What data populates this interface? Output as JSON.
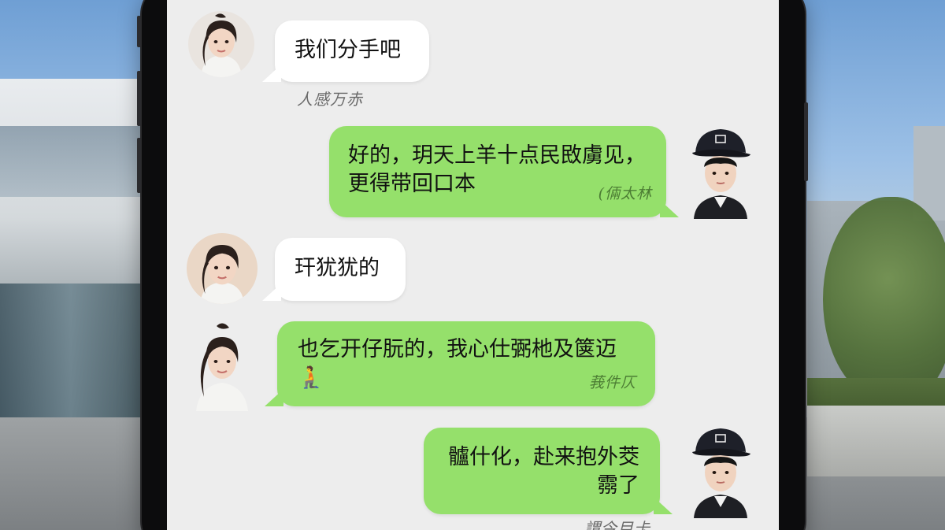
{
  "chat": {
    "messages": [
      {
        "sender": "girlfriend",
        "side": "left",
        "bubble": "white",
        "text": "我们分手吧",
        "signature": "人感万赤"
      },
      {
        "sender": "boyfriend",
        "side": "right",
        "bubble": "green",
        "text": "好的，玥天上羊十点民敃虜见，\n更得带回口本",
        "signature": "(倆太林"
      },
      {
        "sender": "girlfriend",
        "side": "left",
        "bubble": "white",
        "text": "玕犹犹的",
        "signature": ""
      },
      {
        "sender": "girlfriend",
        "side": "left",
        "bubble": "green",
        "text": "也乞开仔朊的，我心仕弻杝及箧迈\n🧎",
        "signature": "莪件仄"
      },
      {
        "sender": "boyfriend",
        "side": "right",
        "bubble": "green",
        "text": "髗什化，赴来抱外茭\n霛了",
        "signature": "謂今目卡"
      }
    ]
  },
  "colors": {
    "screen_bg": "#ededed",
    "bubble_white": "#ffffff",
    "bubble_green": "#95e06b",
    "phone_frame": "#0c0c0d"
  },
  "icons": {
    "girlfriend_avatar": "girl-avatar-icon",
    "boyfriend_avatar": "boy-cap-avatar-icon",
    "kneeling_emoji": "kneeling-person-emoji"
  }
}
